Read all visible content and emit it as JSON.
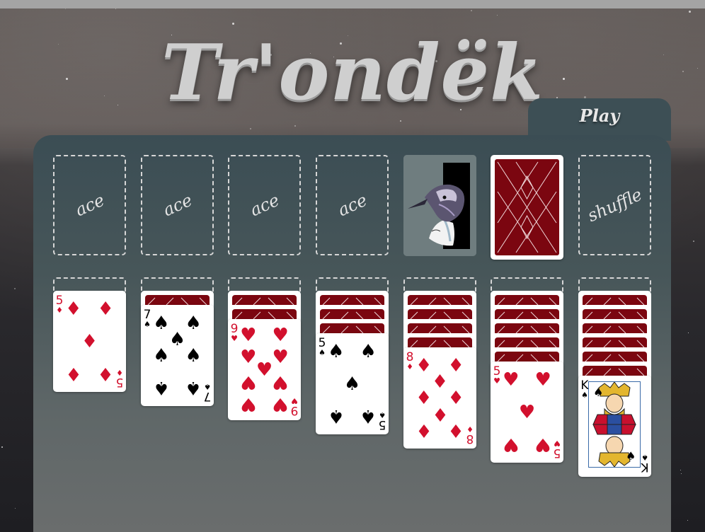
{
  "app": {
    "title": "Tr'ondëk",
    "play_label": "Play"
  },
  "foundations": [
    {
      "label": "ace"
    },
    {
      "label": "ace"
    },
    {
      "label": "ace"
    },
    {
      "label": "ace"
    }
  ],
  "shuffle_label": "shuffle",
  "colors": {
    "board_top": "#3b4d54",
    "card_back": "#7b0610",
    "red_suit": "#d2102d"
  },
  "tableau": [
    {
      "hidden": 0,
      "top": {
        "rank": "5",
        "suit": "diamonds",
        "color": "red"
      }
    },
    {
      "hidden": 1,
      "top": {
        "rank": "7",
        "suit": "spades",
        "color": "black"
      }
    },
    {
      "hidden": 2,
      "top": {
        "rank": "9",
        "suit": "hearts",
        "color": "red"
      }
    },
    {
      "hidden": 3,
      "top": {
        "rank": "5",
        "suit": "spades",
        "color": "black"
      }
    },
    {
      "hidden": 4,
      "top": {
        "rank": "8",
        "suit": "diamonds",
        "color": "red"
      }
    },
    {
      "hidden": 5,
      "top": {
        "rank": "5",
        "suit": "hearts",
        "color": "red"
      }
    },
    {
      "hidden": 6,
      "top": {
        "rank": "K",
        "suit": "spades",
        "color": "black"
      }
    }
  ]
}
